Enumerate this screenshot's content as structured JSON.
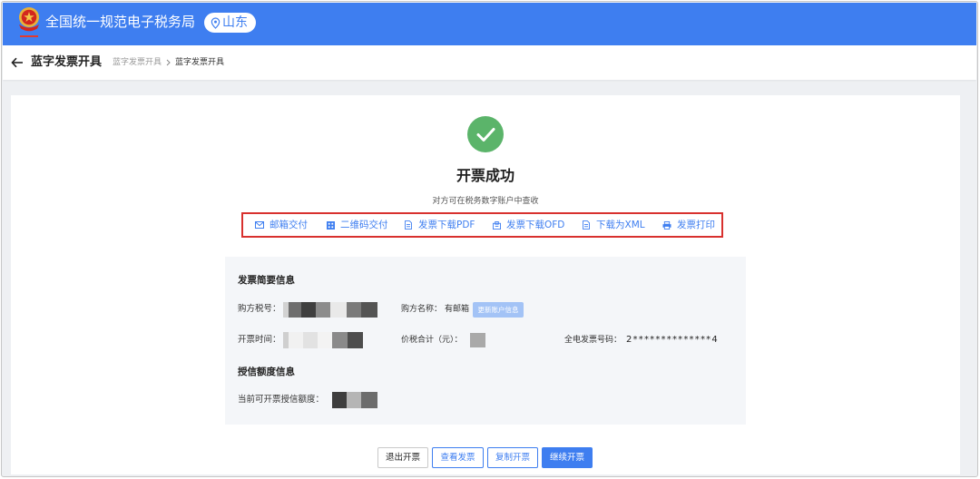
{
  "header": {
    "title": "全国统一规范电子税务局",
    "region": "山东",
    "logo_icon": "national-emblem-icon",
    "region_icon": "location-pin-icon"
  },
  "subheader": {
    "title": "蓝字发票开具",
    "back_icon": "back-arrow-icon",
    "breadcrumb": [
      "蓝字发票开具",
      "蓝字发票开具"
    ]
  },
  "result": {
    "icon": "success-check-icon",
    "title": "开票成功",
    "subtitle": "对方可在税务数字账户中查收"
  },
  "actions": [
    {
      "label": "邮箱交付",
      "icon": "envelope-icon"
    },
    {
      "label": "二维码交付",
      "icon": "qr-code-icon"
    },
    {
      "label": "发票下载PDF",
      "icon": "document-icon"
    },
    {
      "label": "发票下载OFD",
      "icon": "file-download-icon"
    },
    {
      "label": "下载为XML",
      "icon": "document-icon"
    },
    {
      "label": "发票打印",
      "icon": "printer-icon"
    }
  ],
  "summary": {
    "heading": "发票简要信息",
    "buyer_tax_id_label": "购方税号：",
    "buyer_name_label": "购方名称：",
    "buyer_name_value": "有邮箱",
    "update_button": "更新账户信息",
    "issue_time_label": "开票时间：",
    "total_label": "价税合计（元）：",
    "invoice_no_label": "全电发票号码：",
    "invoice_no_value": "2**************4"
  },
  "credit": {
    "heading": "授信额度信息",
    "available_label": "当前可开票授信额度："
  },
  "footer_buttons": {
    "exit": "退出开票",
    "view": "查看发票",
    "copy": "复制开票",
    "continue": "继续开票"
  },
  "theme": {
    "primary": "#3e7ef0",
    "success": "#5bb46a",
    "highlight": "#d8312e"
  }
}
